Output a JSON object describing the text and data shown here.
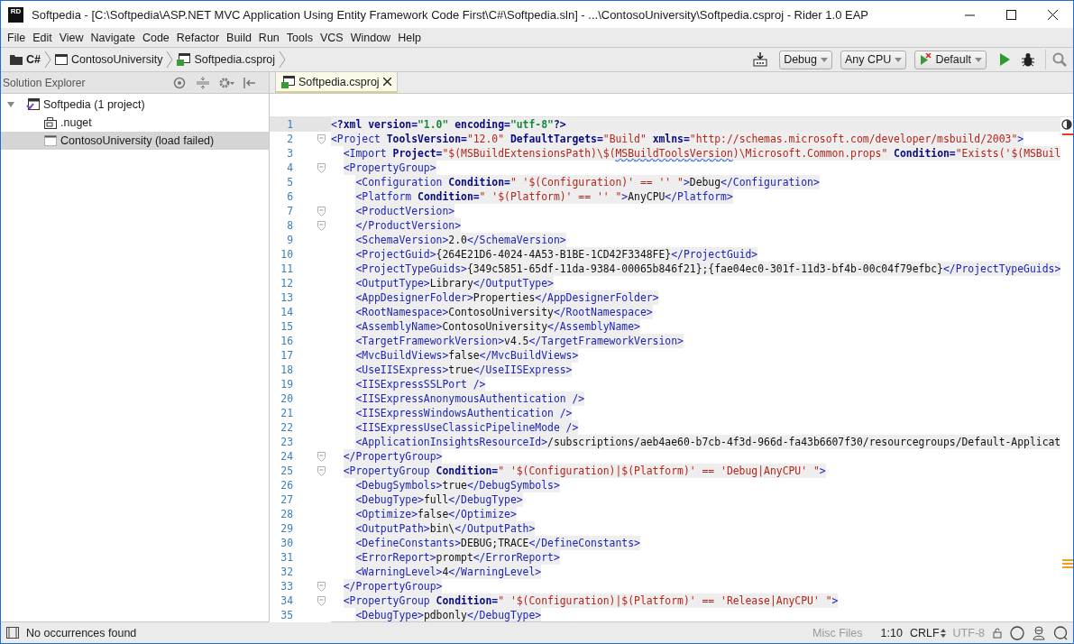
{
  "window": {
    "title": "Softpedia - [C:\\Softpedia\\ASP.NET MVC Application Using Entity Framework Code First\\C#\\Softpedia.sln] - ...\\ContosoUniversity\\Softpedia.csproj - Rider 1.0 EAP",
    "app_badge": "RD"
  },
  "menu": [
    "File",
    "Edit",
    "View",
    "Navigate",
    "Code",
    "Refactor",
    "Build",
    "Run",
    "Tools",
    "VCS",
    "Window",
    "Help"
  ],
  "breadcrumbs": [
    {
      "label": "C#",
      "kind": "folder"
    },
    {
      "label": "ContosoUniversity",
      "kind": "project"
    },
    {
      "label": "Softpedia.csproj",
      "kind": "csfile"
    }
  ],
  "toolbar": {
    "combos": [
      {
        "label": "Debug",
        "kind": "plain"
      },
      {
        "label": "Any CPU",
        "kind": "plain"
      },
      {
        "label": "Default",
        "kind": "runconfig"
      }
    ]
  },
  "sidebar": {
    "title": "Solution Explorer",
    "tree": [
      {
        "label": "Softpedia (1 project)",
        "kind": "solution",
        "expanded": true,
        "selected": false,
        "children": [
          {
            "label": ".nuget",
            "kind": "folder",
            "selected": false
          },
          {
            "label": "ContosoUniversity (load failed)",
            "kind": "failed",
            "selected": true
          }
        ]
      }
    ]
  },
  "tabs": [
    {
      "label": "Softpedia.csproj",
      "selected": true
    }
  ],
  "editor": {
    "lines": [
      {
        "number": "1",
        "fold": false,
        "current": true,
        "tokens": [
          {
            "kind": "tag",
            "text": "<"
          },
          {
            "kind": "attr",
            "text": "?xml version="
          },
          {
            "kind": "pival",
            "text": "\"1.0\""
          },
          {
            "kind": "attr",
            "text": " encoding="
          },
          {
            "kind": "pival",
            "text": "\"utf-8\""
          },
          {
            "kind": "attr",
            "text": "?>"
          }
        ]
      },
      {
        "number": "2",
        "fold": true,
        "current": false,
        "tokens": [
          {
            "kind": "tag",
            "text": "<Project"
          },
          {
            "kind": "attr",
            "text": " ToolsVersion="
          },
          {
            "kind": "value",
            "text": "\"12.0\""
          },
          {
            "kind": "attr",
            "text": " DefaultTargets="
          },
          {
            "kind": "value",
            "text": "\"Build\""
          },
          {
            "kind": "attr",
            "text": " xmlns="
          },
          {
            "kind": "value",
            "text": "\"http://schemas.microsoft.com/developer/msbuild/2003\""
          },
          {
            "kind": "tag",
            "text": ">"
          }
        ]
      },
      {
        "number": "3",
        "fold": false,
        "current": false,
        "tokens": [
          {
            "kind": "tag",
            "text": "  <Import"
          },
          {
            "kind": "attr",
            "text": " Project="
          },
          {
            "kind": "value",
            "text": "\"$(MSBuildExtensionsPath)\\$("
          },
          {
            "kind": "warn",
            "text": "MSBuildToolsVersion"
          },
          {
            "kind": "value",
            "text": ")\\Microsoft.Common.props\""
          },
          {
            "kind": "attr",
            "text": " Condition="
          },
          {
            "kind": "value",
            "text": "\"Exists('$(MSBuil"
          }
        ]
      },
      {
        "number": "4",
        "fold": true,
        "current": false,
        "tokens": [
          {
            "kind": "tag",
            "text": "  <PropertyGroup>"
          }
        ]
      },
      {
        "number": "5",
        "fold": false,
        "current": false,
        "tokens": [
          {
            "kind": "tag",
            "text": "    <Configuration"
          },
          {
            "kind": "attr",
            "text": " Condition="
          },
          {
            "kind": "value",
            "text": "\" '$(Configuration)' == '' \""
          },
          {
            "kind": "tag",
            "text": ">"
          },
          {
            "kind": "text",
            "text": "Debug"
          },
          {
            "kind": "tag",
            "text": "</Configuration>"
          }
        ]
      },
      {
        "number": "6",
        "fold": false,
        "current": false,
        "tokens": [
          {
            "kind": "tag",
            "text": "    <Platform"
          },
          {
            "kind": "attr",
            "text": " Condition="
          },
          {
            "kind": "value",
            "text": "\" '$(Platform)' == '' \""
          },
          {
            "kind": "tag",
            "text": ">"
          },
          {
            "kind": "text",
            "text": "AnyCPU"
          },
          {
            "kind": "tag",
            "text": "</Platform>"
          }
        ]
      },
      {
        "number": "7",
        "fold": true,
        "current": false,
        "tokens": [
          {
            "kind": "tag",
            "text": "    <ProductVersion>"
          }
        ]
      },
      {
        "number": "8",
        "fold": true,
        "current": false,
        "tokens": [
          {
            "kind": "tag",
            "text": "    </ProductVersion>"
          }
        ]
      },
      {
        "number": "9",
        "fold": false,
        "current": false,
        "tokens": [
          {
            "kind": "tag",
            "text": "    <SchemaVersion>"
          },
          {
            "kind": "text",
            "text": "2.0"
          },
          {
            "kind": "tag",
            "text": "</SchemaVersion>"
          }
        ]
      },
      {
        "number": "10",
        "fold": false,
        "current": false,
        "tokens": [
          {
            "kind": "tag",
            "text": "    <ProjectGuid>"
          },
          {
            "kind": "text",
            "text": "{264E21D6-4024-4A53-B1BE-1CD42F3348FE}"
          },
          {
            "kind": "tag",
            "text": "</ProjectGuid>"
          }
        ]
      },
      {
        "number": "11",
        "fold": false,
        "current": false,
        "tokens": [
          {
            "kind": "tag",
            "text": "    <ProjectTypeGuids>"
          },
          {
            "kind": "text",
            "text": "{349c5851-65df-11da-9384-00065b846f21};{fae04ec0-301f-11d3-bf4b-00c04f79efbc}"
          },
          {
            "kind": "tag",
            "text": "</ProjectTypeGuids>"
          }
        ]
      },
      {
        "number": "12",
        "fold": false,
        "current": false,
        "tokens": [
          {
            "kind": "tag",
            "text": "    <OutputType>"
          },
          {
            "kind": "text",
            "text": "Library"
          },
          {
            "kind": "tag",
            "text": "</OutputType>"
          }
        ]
      },
      {
        "number": "13",
        "fold": false,
        "current": false,
        "tokens": [
          {
            "kind": "tag",
            "text": "    <AppDesignerFolder>"
          },
          {
            "kind": "text",
            "text": "Properties"
          },
          {
            "kind": "tag",
            "text": "</AppDesignerFolder>"
          }
        ]
      },
      {
        "number": "14",
        "fold": false,
        "current": false,
        "tokens": [
          {
            "kind": "tag",
            "text": "    <RootNamespace>"
          },
          {
            "kind": "text",
            "text": "ContosoUniversity"
          },
          {
            "kind": "tag",
            "text": "</RootNamespace>"
          }
        ]
      },
      {
        "number": "15",
        "fold": false,
        "current": false,
        "tokens": [
          {
            "kind": "tag",
            "text": "    <AssemblyName>"
          },
          {
            "kind": "text",
            "text": "ContosoUniversity"
          },
          {
            "kind": "tag",
            "text": "</AssemblyName>"
          }
        ]
      },
      {
        "number": "16",
        "fold": false,
        "current": false,
        "tokens": [
          {
            "kind": "tag",
            "text": "    <TargetFrameworkVersion>"
          },
          {
            "kind": "text",
            "text": "v4.5"
          },
          {
            "kind": "tag",
            "text": "</TargetFrameworkVersion>"
          }
        ]
      },
      {
        "number": "17",
        "fold": false,
        "current": false,
        "tokens": [
          {
            "kind": "tag",
            "text": "    <MvcBuildViews>"
          },
          {
            "kind": "text",
            "text": "false"
          },
          {
            "kind": "tag",
            "text": "</MvcBuildViews>"
          }
        ]
      },
      {
        "number": "18",
        "fold": false,
        "current": false,
        "tokens": [
          {
            "kind": "tag",
            "text": "    <UseIISExpress>"
          },
          {
            "kind": "text",
            "text": "true"
          },
          {
            "kind": "tag",
            "text": "</UseIISExpress>"
          }
        ]
      },
      {
        "number": "19",
        "fold": false,
        "current": false,
        "tokens": [
          {
            "kind": "tag",
            "text": "    <IISExpressSSLPort />"
          }
        ]
      },
      {
        "number": "20",
        "fold": false,
        "current": false,
        "tokens": [
          {
            "kind": "tag",
            "text": "    <IISExpressAnonymousAuthentication />"
          }
        ]
      },
      {
        "number": "21",
        "fold": false,
        "current": false,
        "tokens": [
          {
            "kind": "tag",
            "text": "    <IISExpressWindowsAuthentication />"
          }
        ]
      },
      {
        "number": "22",
        "fold": false,
        "current": false,
        "tokens": [
          {
            "kind": "tag",
            "text": "    <IISExpressUseClassicPipelineMode />"
          }
        ]
      },
      {
        "number": "23",
        "fold": false,
        "current": false,
        "tokens": [
          {
            "kind": "tag",
            "text": "    <ApplicationInsightsResourceId>"
          },
          {
            "kind": "text",
            "text": "/subscriptions/aeb4ae60-b7cb-4f3d-966d-fa43b6607f30/resourcegroups/Default-Applicat"
          }
        ]
      },
      {
        "number": "24",
        "fold": true,
        "current": false,
        "tokens": [
          {
            "kind": "tag",
            "text": "  </PropertyGroup>"
          }
        ]
      },
      {
        "number": "25",
        "fold": true,
        "current": false,
        "tokens": [
          {
            "kind": "tag",
            "text": "  <PropertyGroup"
          },
          {
            "kind": "attr",
            "text": " Condition="
          },
          {
            "kind": "value",
            "text": "\" '$(Configuration)|$(Platform)' == 'Debug|AnyCPU' \""
          },
          {
            "kind": "tag",
            "text": ">"
          }
        ]
      },
      {
        "number": "26",
        "fold": false,
        "current": false,
        "tokens": [
          {
            "kind": "tag",
            "text": "    <DebugSymbols>"
          },
          {
            "kind": "text",
            "text": "true"
          },
          {
            "kind": "tag",
            "text": "</DebugSymbols>"
          }
        ]
      },
      {
        "number": "27",
        "fold": false,
        "current": false,
        "tokens": [
          {
            "kind": "tag",
            "text": "    <DebugType>"
          },
          {
            "kind": "text",
            "text": "full"
          },
          {
            "kind": "tag",
            "text": "</DebugType>"
          }
        ]
      },
      {
        "number": "28",
        "fold": false,
        "current": false,
        "tokens": [
          {
            "kind": "tag",
            "text": "    <Optimize>"
          },
          {
            "kind": "text",
            "text": "false"
          },
          {
            "kind": "tag",
            "text": "</Optimize>"
          }
        ]
      },
      {
        "number": "29",
        "fold": false,
        "current": false,
        "tokens": [
          {
            "kind": "tag",
            "text": "    <OutputPath>"
          },
          {
            "kind": "text",
            "text": "bin\\"
          },
          {
            "kind": "tag",
            "text": "</OutputPath>"
          }
        ]
      },
      {
        "number": "30",
        "fold": false,
        "current": false,
        "tokens": [
          {
            "kind": "tag",
            "text": "    <DefineConstants>"
          },
          {
            "kind": "text",
            "text": "DEBUG;TRACE"
          },
          {
            "kind": "tag",
            "text": "</DefineConstants>"
          }
        ]
      },
      {
        "number": "31",
        "fold": false,
        "current": false,
        "tokens": [
          {
            "kind": "tag",
            "text": "    <ErrorReport>"
          },
          {
            "kind": "text",
            "text": "prompt"
          },
          {
            "kind": "tag",
            "text": "</ErrorReport>"
          }
        ]
      },
      {
        "number": "32",
        "fold": false,
        "current": false,
        "tokens": [
          {
            "kind": "tag",
            "text": "    <WarningLevel>"
          },
          {
            "kind": "text",
            "text": "4"
          },
          {
            "kind": "tag",
            "text": "</WarningLevel>"
          }
        ]
      },
      {
        "number": "33",
        "fold": true,
        "current": false,
        "tokens": [
          {
            "kind": "tag",
            "text": "  </PropertyGroup>"
          }
        ]
      },
      {
        "number": "34",
        "fold": true,
        "current": false,
        "tokens": [
          {
            "kind": "tag",
            "text": "  <PropertyGroup"
          },
          {
            "kind": "attr",
            "text": " Condition="
          },
          {
            "kind": "value",
            "text": "\" '$(Configuration)|$(Platform)' == 'Release|AnyCPU' \""
          },
          {
            "kind": "tag",
            "text": ">"
          }
        ]
      },
      {
        "number": "35",
        "fold": false,
        "current": false,
        "tokens": [
          {
            "kind": "tag",
            "text": "    <DebugType>"
          },
          {
            "kind": "text",
            "text": "pdbonly"
          },
          {
            "kind": "tag",
            "text": "</DebugType>"
          }
        ]
      }
    ]
  },
  "status_bar": {
    "message": "No occurrences found",
    "file_type": "Misc Files",
    "position": "1:10",
    "line_ending": "CRLF",
    "encoding": "UTF-8"
  }
}
